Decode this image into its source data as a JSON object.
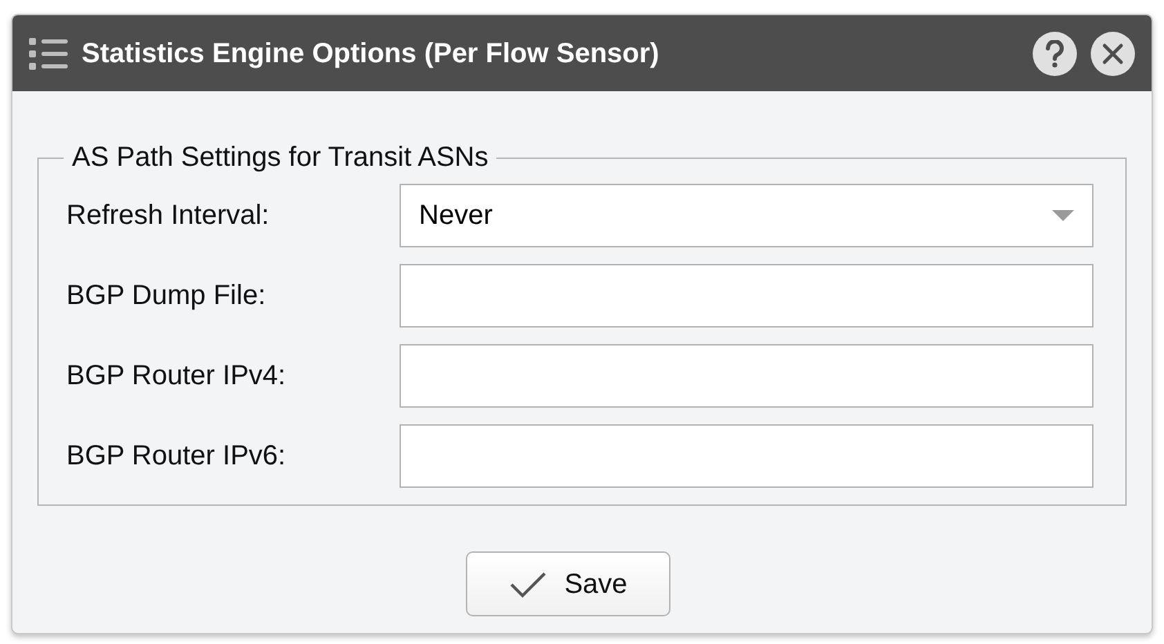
{
  "window": {
    "title": "Statistics Engine Options (Per Flow Sensor)"
  },
  "group": {
    "legend": "AS Path Settings for Transit ASNs"
  },
  "fields": [
    {
      "kind": "select",
      "label": "Refresh Interval:",
      "value": "Never"
    },
    {
      "kind": "text",
      "label": "BGP Dump File:"
    },
    {
      "kind": "text",
      "label": "BGP Router IPv4:"
    },
    {
      "kind": "text",
      "label": "BGP Router IPv6:"
    }
  ],
  "buttons": [
    {
      "label": "Save"
    }
  ]
}
